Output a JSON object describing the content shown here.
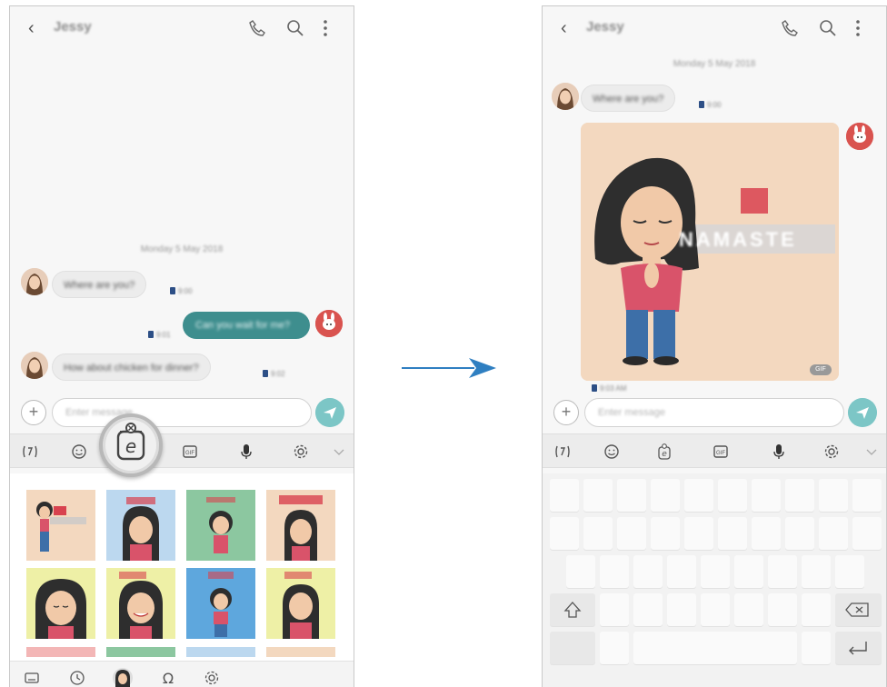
{
  "left_screen": {
    "header": {
      "contact_name": "Jessy"
    },
    "date_separator": "Monday 5 May 2018",
    "messages": [
      {
        "direction": "in",
        "text": "Where are you?",
        "meta": "9:00"
      },
      {
        "direction": "out",
        "text": "Can you wait for me?",
        "meta": "9:01"
      },
      {
        "direction": "in",
        "text": "How about chicken for dinner?",
        "meta": "9:02"
      }
    ],
    "composer": {
      "placeholder": "Enter message"
    },
    "sticker_bar_icons": [
      "keyboard-icon",
      "recent-clock-icon",
      "ar-emoji-avatar-icon",
      "special-char-omega-icon",
      "settings-icon"
    ]
  },
  "right_screen": {
    "header": {
      "contact_name": "Jessy"
    },
    "date_separator": "Monday 5 May 2018",
    "messages": [
      {
        "direction": "in",
        "text": "Where are you?",
        "meta": "9:00"
      }
    ],
    "sticker_message": {
      "caption_text": "NAMASTE",
      "duration_badge": "GIF",
      "meta": "9:03 AM"
    },
    "composer": {
      "placeholder": "Enter message"
    }
  },
  "keyboard_toolbar_icons": [
    "bixby-voice-icon",
    "emoji-icon",
    "ar-emoji-icon",
    "sticker-icon",
    "microphone-icon",
    "settings-icon",
    "chevron-down-icon"
  ],
  "colors": {
    "accent_teal": "#3e8e8e",
    "send_button": "#7cc6c6",
    "arrow_blue": "#2f7fc1",
    "sticker_bg": "#f3d8bf"
  }
}
